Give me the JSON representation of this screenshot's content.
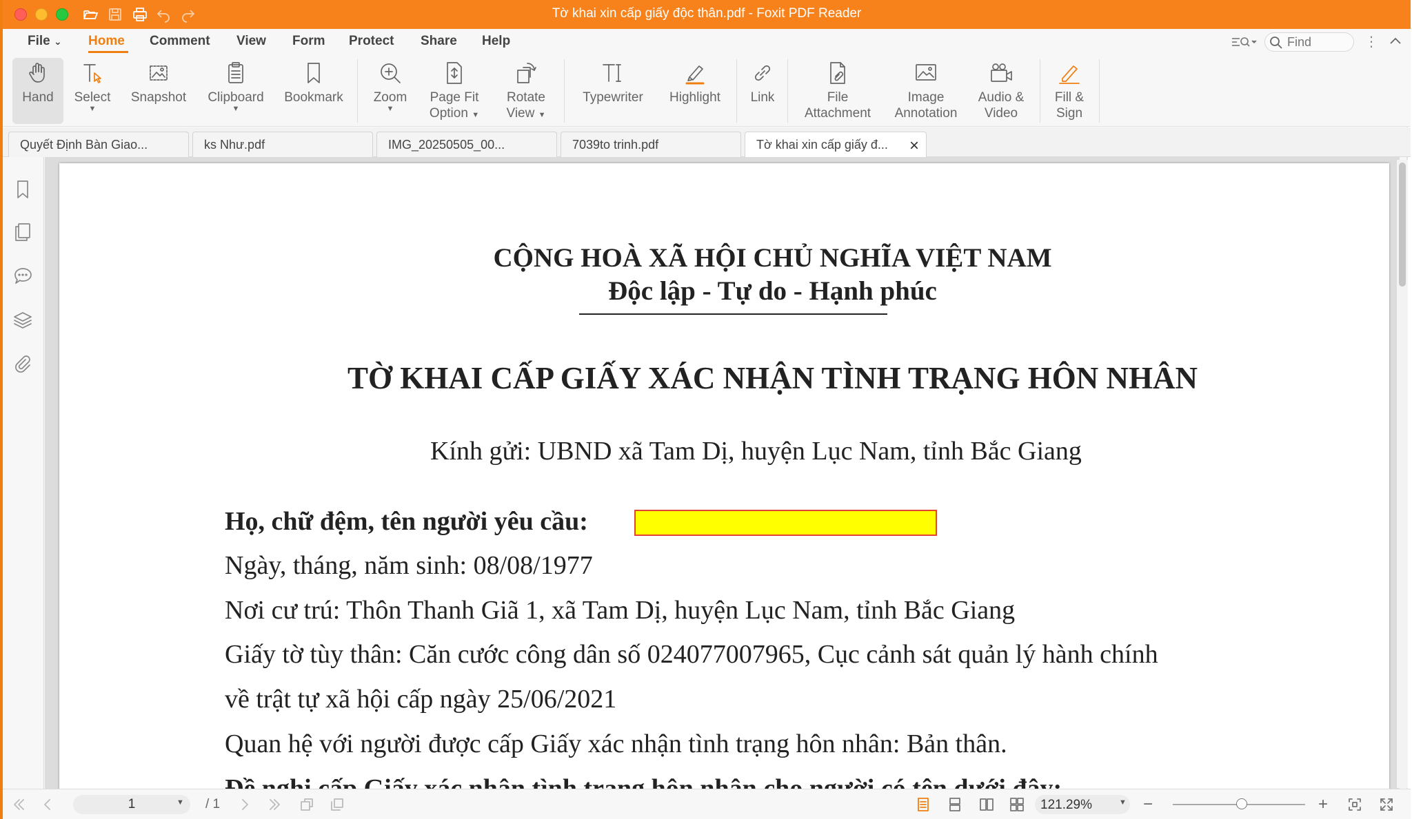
{
  "window": {
    "title": "Tờ khai xin cấp giấy độc thân.pdf - Foxit PDF Reader"
  },
  "quick_access": [
    {
      "icon": "folder-open-icon"
    },
    {
      "icon": "save-icon"
    },
    {
      "icon": "print-icon"
    },
    {
      "icon": "undo-icon"
    },
    {
      "icon": "redo-icon"
    }
  ],
  "menu": {
    "file": "File",
    "home": "Home",
    "comment": "Comment",
    "view": "View",
    "form": "Form",
    "protect": "Protect",
    "share": "Share",
    "help": "Help",
    "active": "Home",
    "accent_color": "#f07f11"
  },
  "search": {
    "placeholder": "Find"
  },
  "ribbon": {
    "hand": "Hand",
    "select": "Select",
    "snapshot": "Snapshot",
    "clipboard": "Clipboard",
    "bookmark": "Bookmark",
    "zoom": "Zoom",
    "page_fit_1": "Page Fit",
    "page_fit_2": "Option",
    "rotate_1": "Rotate",
    "rotate_2": "View",
    "typewriter": "Typewriter",
    "highlight": "Highlight",
    "link": "Link",
    "file_attach_1": "File",
    "file_attach_2": "Attachment",
    "image_annot_1": "Image",
    "image_annot_2": "Annotation",
    "audio_1": "Audio &",
    "audio_2": "Video",
    "fill_1": "Fill &",
    "fill_2": "Sign"
  },
  "tabs": [
    {
      "label": "Quyết Định Bàn Giao..."
    },
    {
      "label": "ks Như.pdf"
    },
    {
      "label": "IMG_20250505_00..."
    },
    {
      "label": "7039to trinh.pdf"
    },
    {
      "label": "Tờ khai xin cấp giấy đ...",
      "active": true
    }
  ],
  "left_panel": [
    {
      "icon": "bookmark-panel-icon"
    },
    {
      "icon": "pages-panel-icon"
    },
    {
      "icon": "comments-panel-icon"
    },
    {
      "icon": "layers-panel-icon"
    },
    {
      "icon": "attachments-panel-icon"
    }
  ],
  "document": {
    "nation": "CỘNG HOÀ XÃ HỘI CHỦ NGHĨA VIỆT NAM",
    "motto": "Độc lập - Tự do - Hạnh phúc",
    "title": "TỜ KHAI CẤP GIẤY XÁC NHẬN TÌNH TRẠNG HÔN NHÂN",
    "addressee": "Kính gửi: UBND xã Tam Dị, huyện Lục Nam, tỉnh Bắc Giang",
    "name_label": "Họ, chữ đệm, tên người yêu cầu:",
    "dob": "Ngày, tháng, năm sinh: 08/08/1977",
    "residence": "Nơi cư trú: Thôn Thanh Giã 1, xã Tam Dị, huyện Lục Nam, tỉnh Bắc Giang",
    "id_doc": "Giấy tờ tùy thân: Căn cước công dân số 024077007965, Cục cảnh sát quản lý hành chính",
    "id_doc_cont": "về trật tự xã hội cấp ngày 25/06/2021",
    "relation": "Quan hệ với người được cấp Giấy xác nhận tình trạng hôn nhân: Bản thân.",
    "request_partial": "Đề nghị cấp Giấy xác nhận tình trạng hôn nhân cho người có tên dưới đây:",
    "redaction_color": "#ffff00"
  },
  "status": {
    "page": "1",
    "page_total": "/ 1",
    "zoom": "121.29%",
    "zoom_minus": "−",
    "zoom_plus": "+"
  }
}
